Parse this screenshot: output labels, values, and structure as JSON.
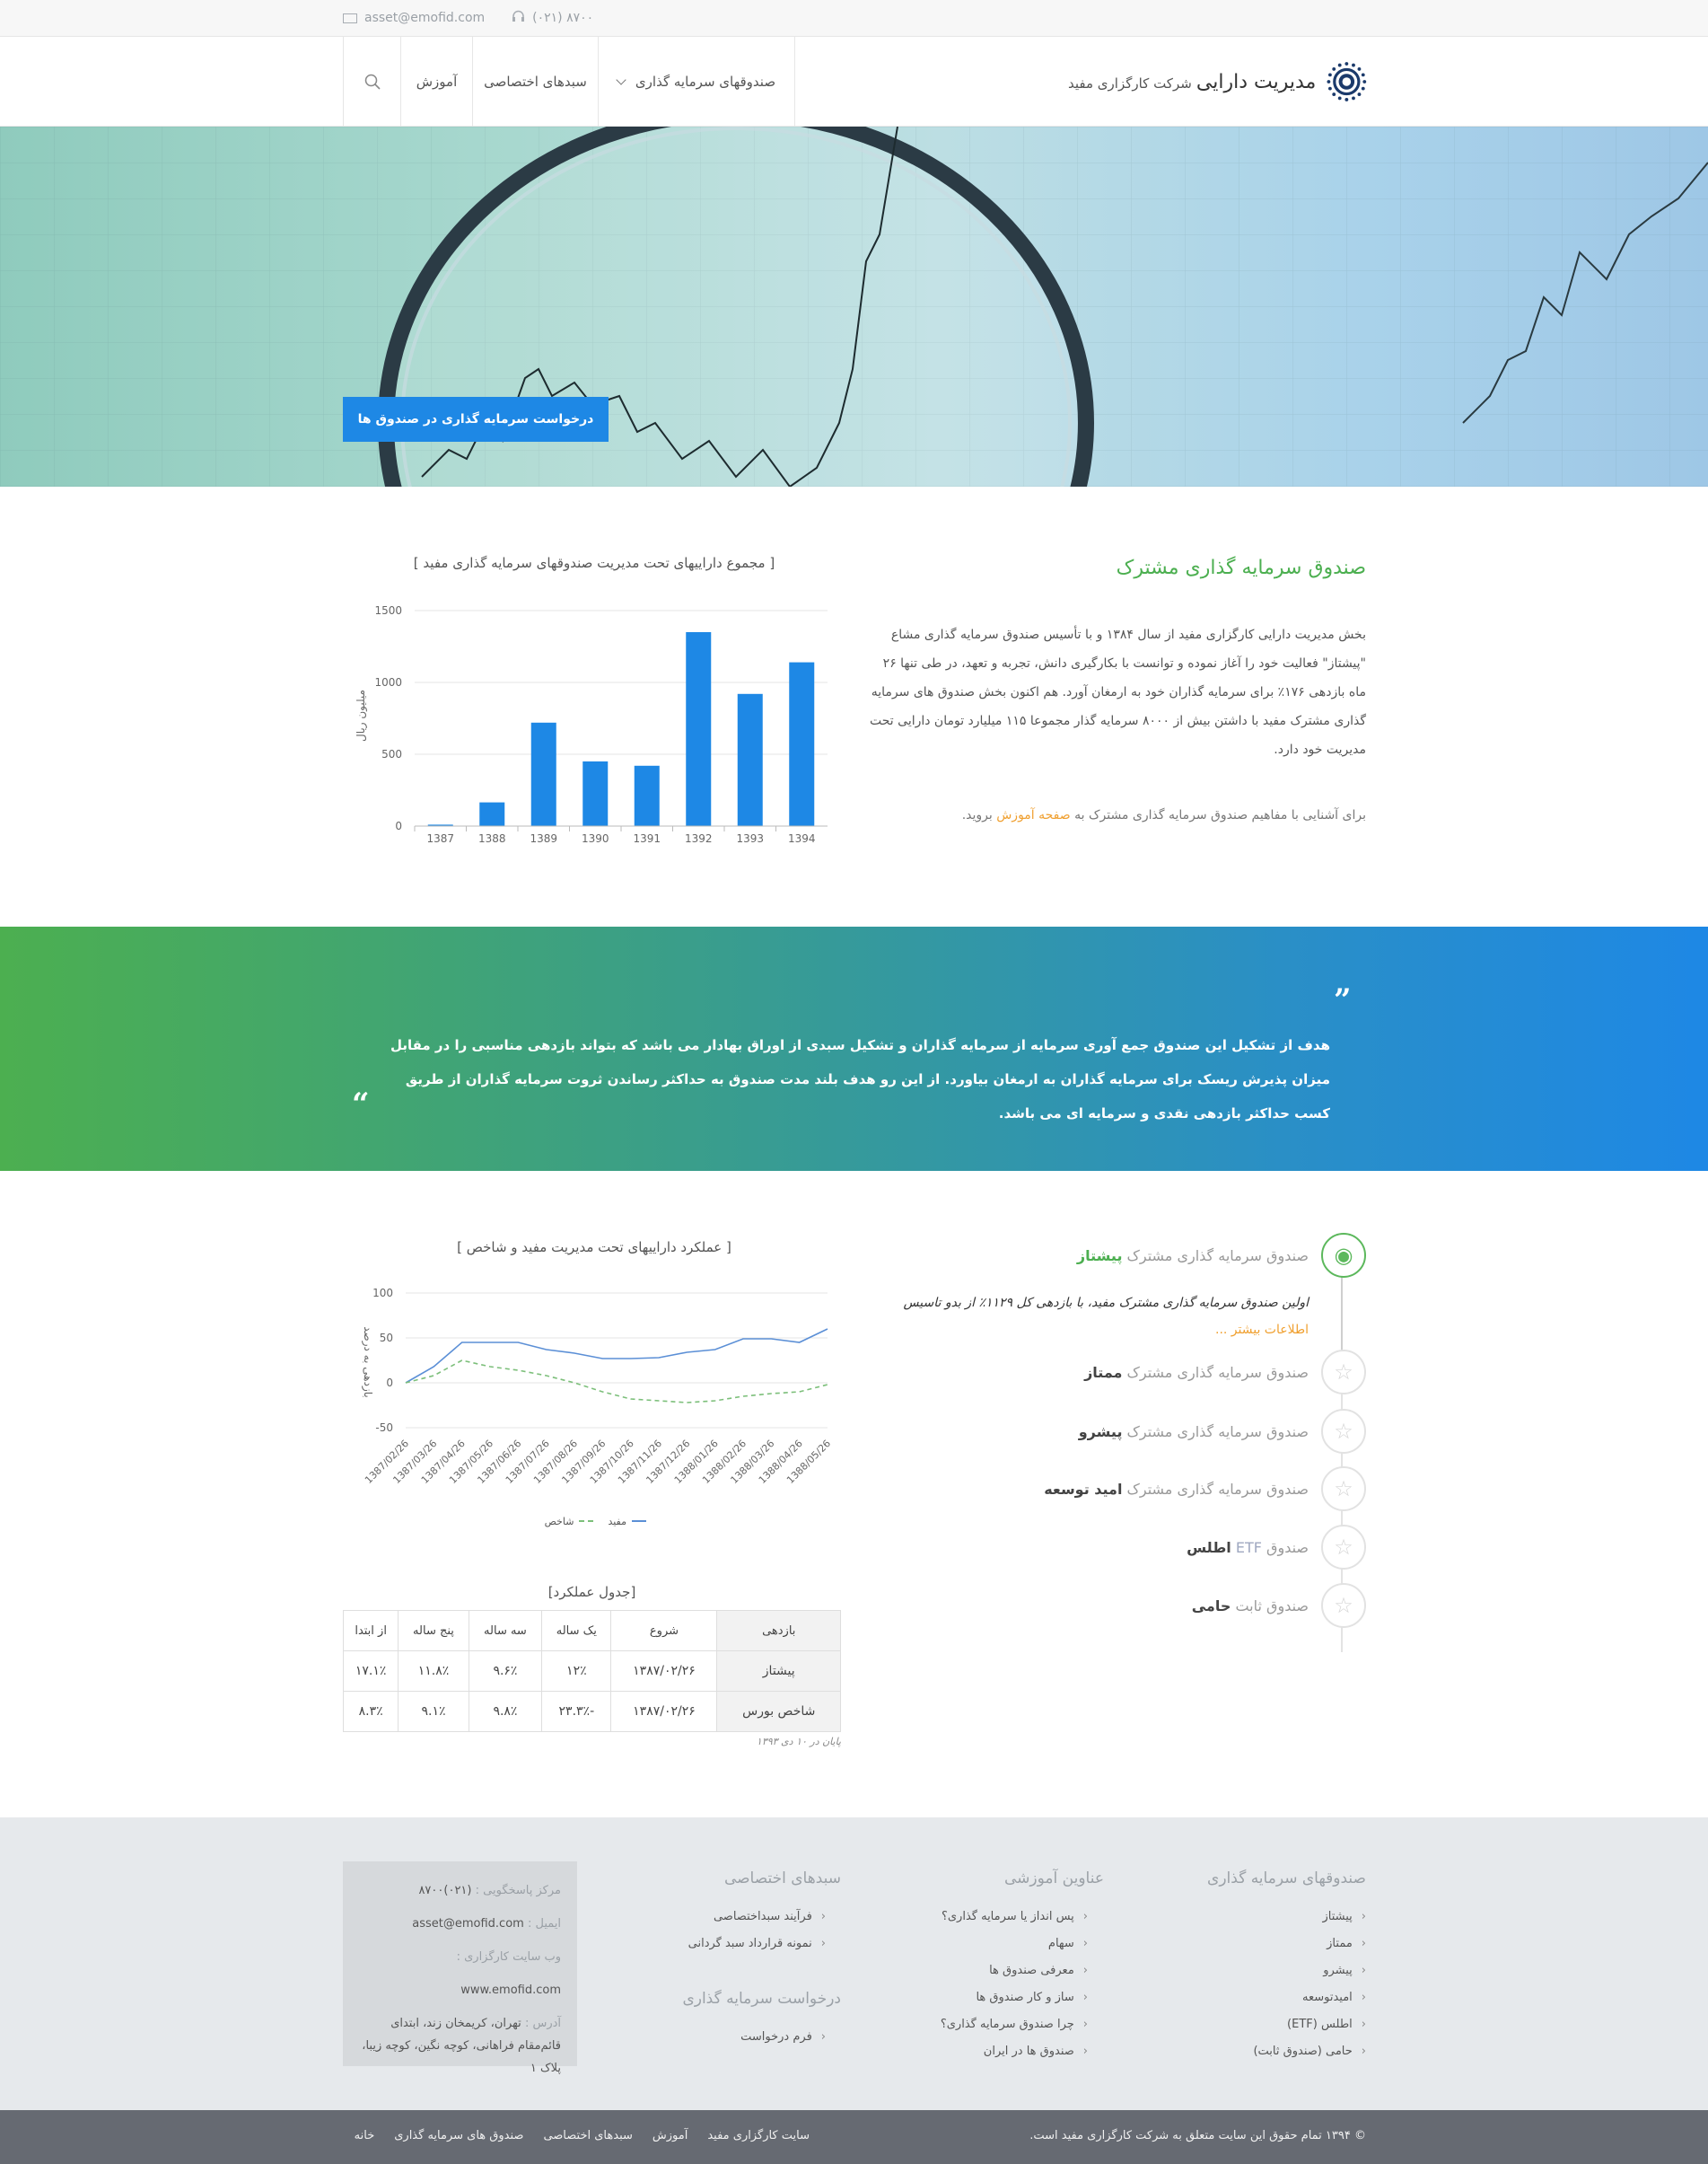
{
  "topbar": {
    "email": "asset@emofid.com",
    "phone": "(۰۲۱) ۸۷۰۰"
  },
  "header": {
    "brand_main": "مدیریت دارایی",
    "brand_sub": "شرکت کارگزاری مفید",
    "nav": {
      "funds": "صندوقهای سرمایه گذاری",
      "baskets": "سبدهای اختصاصی",
      "education": "آموزش"
    }
  },
  "hero": {
    "cta_label": "درخواست سرمایه گذاری در صندوق ها"
  },
  "intro": {
    "title": "صندوق سرمایه گذاری مشترک",
    "paragraph": "بخش مدیریت دارایی کارگزاری مفید از سال ۱۳۸۴ و با تأسیس صندوق سرمایه گذاری مشاع \"پیشتاز\" فعالیت خود را آغاز نموده و توانست با بکارگیری دانش، تجربه و تعهد، در طی تنها ۲۶ ماه بازدهی ۱۷۶٪ برای سرمایه گذاران خود به ارمغان آورد. هم اکنون بخش صندوق های سرمایه گذاری مشترک مفید با داشتن بیش از ۸۰۰۰ سرمایه گذار مجموعا ۱۱۵ میلیارد تومان دارایی تحت مدیریت خود دارد.",
    "edu_prefix": "برای آشنایی با مفاهیم صندوق سرمایه گذاری مشترک به",
    "edu_link": "صفحه آموزش",
    "edu_suffix": "بروید."
  },
  "chart_assets": {
    "title": "[ مجموع داراییهای تحت مدیریت صندوقهای سرمایه گذاری مفید ]",
    "ylabel": "میلیون ریال",
    "yticks": [
      "0",
      "500",
      "1000",
      "1500"
    ]
  },
  "quote": {
    "text": "هدف از تشکیل این صندوق جمع آوری سرمایه از سرمایه گذاران و تشکیل سبدی از اوراق بهادار می باشد که بتواند بازدهی مناسبی را در مقابل میزان پذیرش ریسک برای سرمایه گذاران به ارمغان بیاورد. از این رو هدف بلند مدت صندوق به حداکثر رساندن ثروت سرمایه گذاران از طریق کسب حداکثر بازدهی نقدی و سرمایه ای می باشد.",
    "open_mark": "”",
    "close_mark": "“"
  },
  "funds": {
    "prefix_common": "صندوق سرمایه گذاری مشترک",
    "prefix_fund": "صندوق",
    "items": [
      {
        "name": "پیشتاز",
        "icon": "eye-icon"
      },
      {
        "name": "ممتاز",
        "icon": "star-icon"
      },
      {
        "name": "پیشرو",
        "icon": "star-icon"
      },
      {
        "name": "امید توسعه",
        "icon": "star-icon"
      },
      {
        "name": "اطلس",
        "etf": "ETF",
        "icon": "star-icon"
      },
      {
        "name": "حامی",
        "fixed": "ثابت",
        "icon": "star-icon"
      }
    ],
    "active_desc": "اولین صندوق سرمایه گذاری مشترک مفید، با بازدهی کل ۱۱۲۹٪ از بدو تاسیس",
    "more_link": "اطلاعات بیشتر ..."
  },
  "chart_perf": {
    "title": "[ عملکرد داراییهای تحت مدیریت مفید و شاخص ]",
    "ylabel": "بازدهی به درصد",
    "yticks": [
      "100",
      "50",
      "0",
      "-50"
    ],
    "legend_mofid": "مفید",
    "legend_index": "شاخص"
  },
  "table": {
    "title": "[جدول عملکرد]",
    "headers": [
      "بازدهی",
      "شروع",
      "یک ساله",
      "سه ساله",
      "پنج ساله",
      "از ابتدا"
    ],
    "rows": [
      [
        "پیشتاز",
        "۱۳۸۷/۰۲/۲۶",
        "۱۲٪",
        "۹.۶٪",
        "۱۱.۸٪",
        "۱۷.۱٪"
      ],
      [
        "شاخص بورس",
        "۱۳۸۷/۰۲/۲۶",
        "-۲۳.۳٪",
        "۹.۸٪",
        "۹.۱٪",
        "۸.۳٪"
      ]
    ],
    "note": "پایان در ۱۰ دی ۱۳۹۳"
  },
  "footer": {
    "funds_head": "صندوقهای سرمایه گذاری",
    "funds_items": [
      "پیشتاز",
      "ممتاز",
      "پیشرو",
      "امیدتوسعه",
      "اطلس (ETF)",
      "حامی (صندوق ثابت)"
    ],
    "edu_head": "عناوین آموزشی",
    "edu_items": [
      "پس انداز یا سرمایه گذاری؟",
      "سهام",
      "معرفی صندوق ها",
      "ساز و کار صندوق ها",
      "چرا صندوق سرمایه گذاری؟",
      "صندوق ها در ایران"
    ],
    "baskets_head": "سبدهای اختصاصی",
    "baskets_items": [
      "فرآیند سبداختصاصی",
      "نمونه قرارداد سبد گردانی"
    ],
    "request_head": "درخواست سرمایه گذاری",
    "request_items": [
      "فرم درخواست"
    ],
    "contact": {
      "support_label": "مرکز پاسخگویی :",
      "support_value": "(۰۲۱)۸۷۰۰",
      "email_label": "ایمیل :",
      "email_value": "asset@emofid.com",
      "web_label": "وب سایت کارگزاری :",
      "web_value": "www.emofid.com",
      "addr_label": "آدرس :",
      "addr_value": "تهران، کریمخان زند، ابتدای قائم‌مقام فراهانی، کوچه نگین، کوچه زیبا، پلاک ۱"
    }
  },
  "bottombar": {
    "copyright": "© ۱۳۹۴ تمام حقوق این سایت متعلق به شرکت کارگزاری مفید است.",
    "links": [
      "خانه",
      "صندوق های سرمایه گذاری",
      "سبدهای اختصاصی",
      "آموزش",
      "سایت کارگزاری مفید"
    ]
  },
  "chart_data": [
    {
      "type": "bar",
      "title": "[ مجموع داراییهای تحت مدیریت صندوقهای سرمایه گذاری مفید ]",
      "ylabel": "میلیون ریال",
      "categories": [
        "1387",
        "1388",
        "1389",
        "1390",
        "1391",
        "1392",
        "1393",
        "1394"
      ],
      "values": [
        10,
        165,
        720,
        450,
        420,
        1350,
        920,
        1140
      ],
      "ylim": [
        0,
        1500
      ],
      "color": "#1e88e5"
    },
    {
      "type": "line",
      "title": "[ عملکرد داراییهای تحت مدیریت مفید و شاخص ]",
      "ylabel": "بازدهی به درصد",
      "x": [
        "1387/02/26",
        "1387/03/26",
        "1387/04/26",
        "1387/05/26",
        "1387/06/26",
        "1387/07/26",
        "1387/08/26",
        "1387/09/26",
        "1387/10/26",
        "1387/11/26",
        "1387/12/26",
        "1388/01/26",
        "1388/02/26",
        "1388/03/26",
        "1388/04/26",
        "1388/05/26"
      ],
      "ylim": [
        -50,
        100
      ],
      "series": [
        {
          "name": "مفید",
          "color": "#5b8fd6",
          "dash": false,
          "values": [
            0,
            18,
            45,
            45,
            45,
            37,
            33,
            27,
            27,
            28,
            34,
            37,
            49,
            49,
            45,
            60
          ]
        },
        {
          "name": "شاخص",
          "color": "#7cbf7a",
          "dash": true,
          "values": [
            0,
            8,
            25,
            18,
            14,
            8,
            0,
            -10,
            -18,
            -20,
            -22,
            -20,
            -15,
            -12,
            -10,
            -2
          ]
        }
      ]
    }
  ]
}
